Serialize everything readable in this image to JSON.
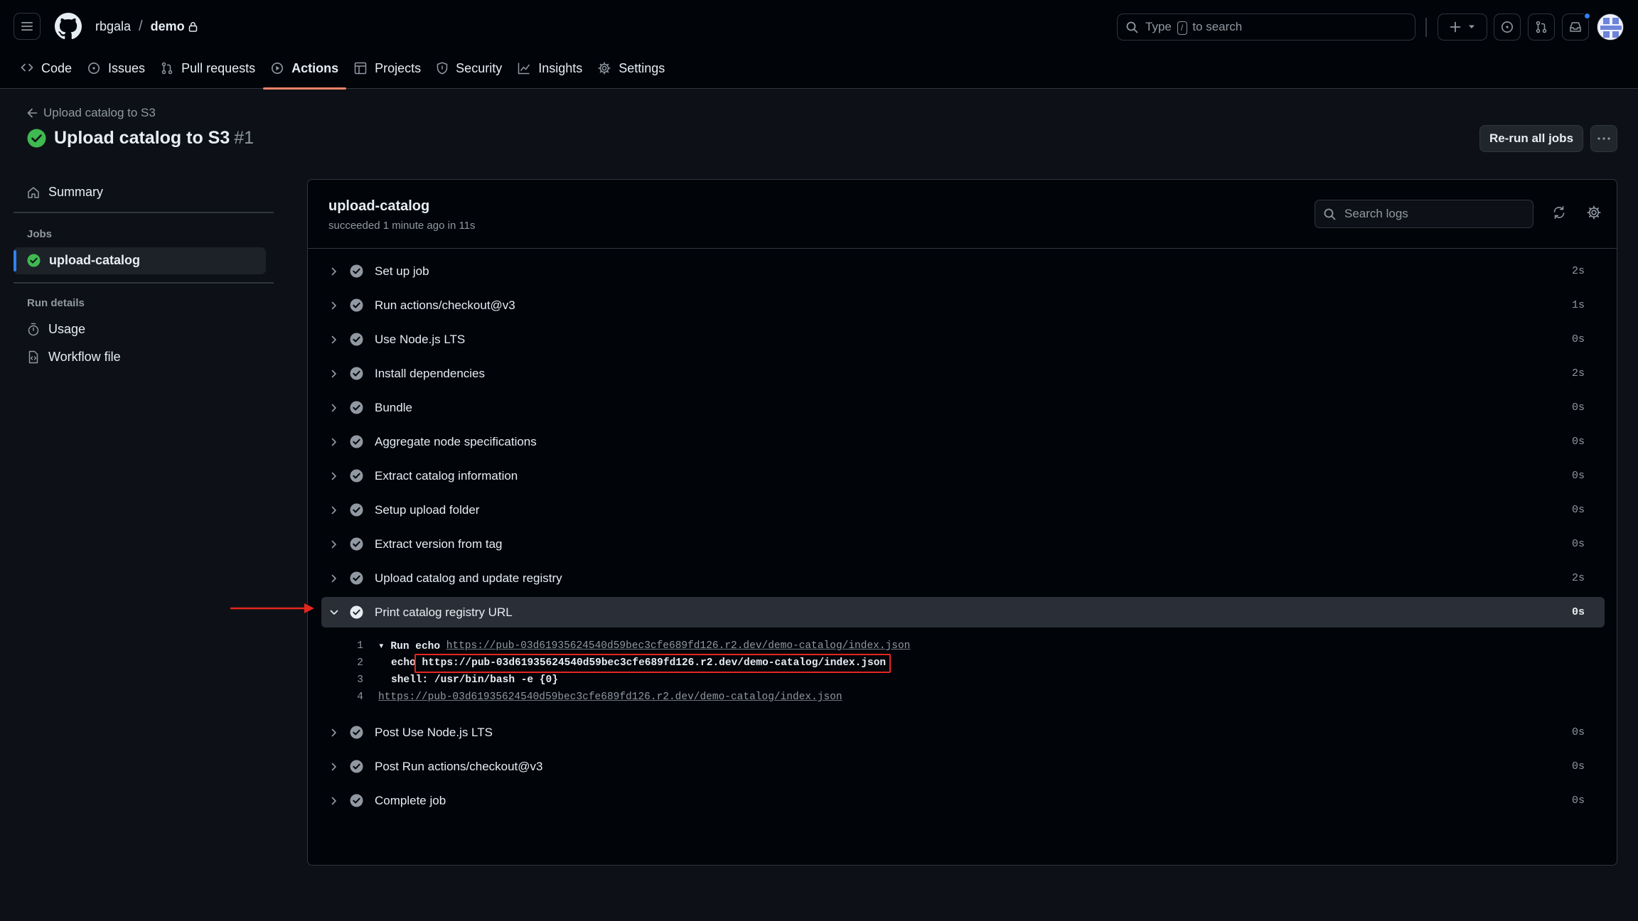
{
  "header": {
    "owner": "rbgala",
    "separator": "/",
    "repo": "demo",
    "search_prefix": "Type",
    "search_key": "/",
    "search_suffix": "to search"
  },
  "repo_tabs": [
    {
      "label": "Code",
      "icon": "code-icon"
    },
    {
      "label": "Issues",
      "icon": "issue-opened-icon"
    },
    {
      "label": "Pull requests",
      "icon": "git-pull-request-icon"
    },
    {
      "label": "Actions",
      "icon": "play-icon",
      "active": true
    },
    {
      "label": "Projects",
      "icon": "table-icon"
    },
    {
      "label": "Security",
      "icon": "shield-icon"
    },
    {
      "label": "Insights",
      "icon": "graph-icon"
    },
    {
      "label": "Settings",
      "icon": "gear-icon"
    }
  ],
  "run": {
    "back_label": "Upload catalog to S3",
    "title": "Upload catalog to S3",
    "number": "#1",
    "rerun_label": "Re-run all jobs"
  },
  "sidebar": {
    "summary_label": "Summary",
    "jobs_heading": "Jobs",
    "job_label": "upload-catalog",
    "run_details_heading": "Run details",
    "usage_label": "Usage",
    "workflow_file_label": "Workflow file"
  },
  "job": {
    "name": "upload-catalog",
    "status": "succeeded 1 minute ago in 11s",
    "search_placeholder": "Search logs"
  },
  "steps_before": [
    {
      "name": "Set up job",
      "duration": "2s"
    },
    {
      "name": "Run actions/checkout@v3",
      "duration": "1s"
    },
    {
      "name": "Use Node.js LTS",
      "duration": "0s"
    },
    {
      "name": "Install dependencies",
      "duration": "2s"
    },
    {
      "name": "Bundle",
      "duration": "0s"
    },
    {
      "name": "Aggregate node specifications",
      "duration": "0s"
    },
    {
      "name": "Extract catalog information",
      "duration": "0s"
    },
    {
      "name": "Setup upload folder",
      "duration": "0s"
    },
    {
      "name": "Extract version from tag",
      "duration": "0s"
    },
    {
      "name": "Upload catalog and update registry",
      "duration": "2s"
    }
  ],
  "expanded_step": {
    "name": "Print catalog registry URL",
    "duration": "0s",
    "log": {
      "l1_num": "1",
      "l1_prefix": "▾ Run echo",
      "l1_url": "https://pub-03d61935624540d59bec3cfe689fd126.r2.dev/demo-catalog/index.json",
      "l2_num": "2",
      "l2_prefix": "echo",
      "l2_url": "https://pub-03d61935624540d59bec3cfe689fd126.r2.dev/demo-catalog/index.json",
      "l3_num": "3",
      "l3_text": "shell: /usr/bin/bash -e {0}",
      "l4_num": "4",
      "l4_url": "https://pub-03d61935624540d59bec3cfe689fd126.r2.dev/demo-catalog/index.json"
    }
  },
  "steps_after": [
    {
      "name": "Post Use Node.js LTS",
      "duration": "0s"
    },
    {
      "name": "Post Run actions/checkout@v3",
      "duration": "0s"
    },
    {
      "name": "Complete job",
      "duration": "0s"
    }
  ],
  "colors": {
    "success": "#3fb950",
    "accent_tab": "#f78166",
    "annotation_red": "#e5261f",
    "notification_blue": "#2f81f7"
  }
}
